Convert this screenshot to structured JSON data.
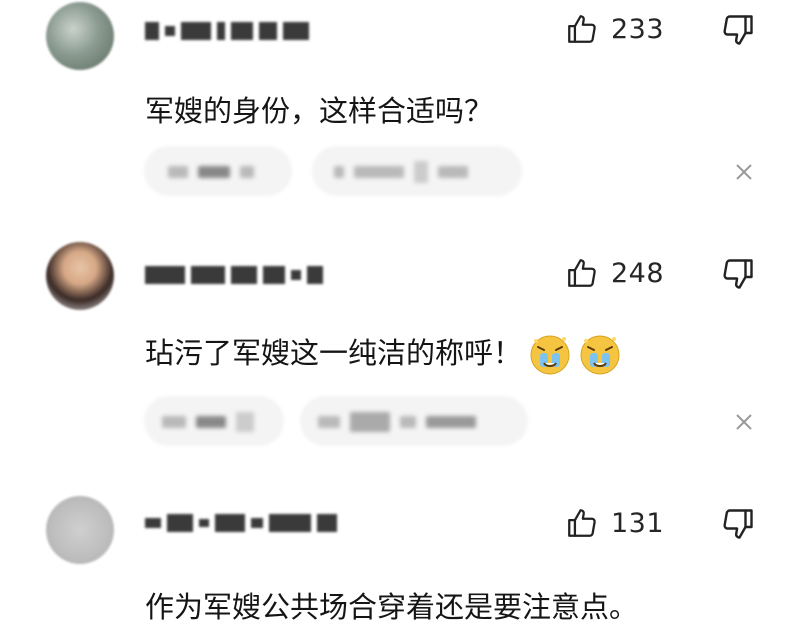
{
  "comments": [
    {
      "avatar": "avatar-blurred",
      "likes": "233",
      "text": "军嫂的身份，这样合适吗？",
      "like_icon": "thumbs-up-icon",
      "dislike_icon": "thumbs-down-icon",
      "close_icon": "close-icon"
    },
    {
      "avatar": "avatar-blurred",
      "likes": "248",
      "text": "玷污了军嫂这一纯洁的称呼！",
      "emojis": [
        "crying-face-emoji",
        "crying-face-emoji"
      ],
      "like_icon": "thumbs-up-icon",
      "dislike_icon": "thumbs-down-icon",
      "close_icon": "close-icon"
    },
    {
      "avatar": "avatar-blurred",
      "likes": "131",
      "text": "作为军嫂公共场合穿着还是要注意点。",
      "like_icon": "thumbs-up-icon",
      "dislike_icon": "thumbs-down-icon"
    }
  ],
  "colors": {
    "text": "#151515",
    "icon": "#222222",
    "blurred_name": "#3a3a3a",
    "blurred_reply": "#b9b9b9",
    "close": "#9a9a9a",
    "emoji": "#f5c542"
  }
}
